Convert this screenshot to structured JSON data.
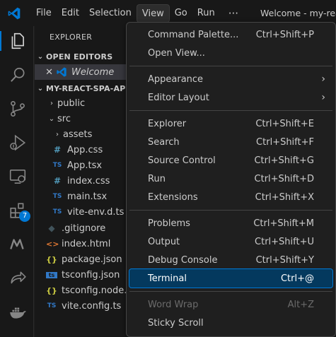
{
  "titlebar": {
    "menus": [
      "File",
      "Edit",
      "Selection",
      "View",
      "Go",
      "Run"
    ],
    "more": "···",
    "window_title": "Welcome - my-react"
  },
  "activity_bar": {
    "icons": [
      "explorer-icon",
      "search-icon",
      "source-control-icon",
      "run-debug-icon",
      "remote-explorer-icon",
      "extensions-icon",
      "mongodb-icon",
      "live-share-icon",
      "docker-icon"
    ],
    "extensions_badge": "7"
  },
  "sidebar": {
    "title": "EXPLORER",
    "open_editors": {
      "title": "OPEN EDITORS",
      "items": [
        {
          "name": "Welcome"
        }
      ]
    },
    "project": {
      "title": "MY-REACT-SPA-APP",
      "items": [
        {
          "name": "public",
          "type": "folder",
          "expanded": false
        },
        {
          "name": "src",
          "type": "folder",
          "expanded": true
        },
        {
          "name": "assets",
          "type": "folder",
          "expanded": false
        },
        {
          "name": "App.css",
          "type": "css"
        },
        {
          "name": "App.tsx",
          "type": "ts"
        },
        {
          "name": "index.css",
          "type": "css"
        },
        {
          "name": "main.tsx",
          "type": "ts"
        },
        {
          "name": "vite-env.d.ts",
          "type": "ts"
        },
        {
          "name": ".gitignore",
          "type": "git"
        },
        {
          "name": "index.html",
          "type": "html"
        },
        {
          "name": "package.json",
          "type": "json"
        },
        {
          "name": "tsconfig.json",
          "type": "ts"
        },
        {
          "name": "tsconfig.node.json",
          "type": "json"
        },
        {
          "name": "vite.config.ts",
          "type": "ts"
        }
      ]
    }
  },
  "view_menu": {
    "groups": [
      [
        {
          "label": "Command Palette...",
          "shortcut": "Ctrl+Shift+P"
        },
        {
          "label": "Open View...",
          "shortcut": ""
        }
      ],
      [
        {
          "label": "Appearance",
          "shortcut": "",
          "submenu": true
        },
        {
          "label": "Editor Layout",
          "shortcut": "",
          "submenu": true
        }
      ],
      [
        {
          "label": "Explorer",
          "shortcut": "Ctrl+Shift+E"
        },
        {
          "label": "Search",
          "shortcut": "Ctrl+Shift+F"
        },
        {
          "label": "Source Control",
          "shortcut": "Ctrl+Shift+G"
        },
        {
          "label": "Run",
          "shortcut": "Ctrl+Shift+D"
        },
        {
          "label": "Extensions",
          "shortcut": "Ctrl+Shift+X"
        }
      ],
      [
        {
          "label": "Problems",
          "shortcut": "Ctrl+Shift+M"
        },
        {
          "label": "Output",
          "shortcut": "Ctrl+Shift+U"
        },
        {
          "label": "Debug Console",
          "shortcut": "Ctrl+Shift+Y"
        },
        {
          "label": "Terminal",
          "shortcut": "Ctrl+@",
          "highlighted": true
        }
      ],
      [
        {
          "label": "Word Wrap",
          "shortcut": "Alt+Z",
          "disabled": true
        },
        {
          "label": "Sticky Scroll",
          "shortcut": ""
        }
      ]
    ]
  },
  "colors": {
    "accent": "#0078d4",
    "menu_highlight": "#04395e",
    "background": "#1f1f1f"
  }
}
